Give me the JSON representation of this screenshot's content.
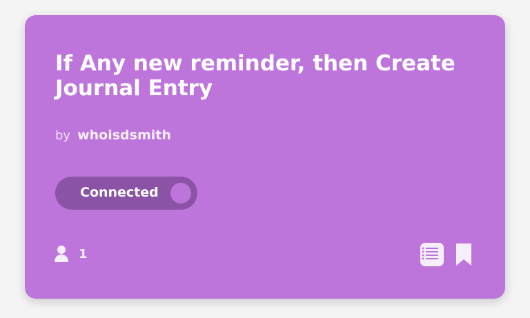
{
  "card": {
    "title": "If Any new reminder, then Create Journal Entry",
    "by_label": "by",
    "author": "whoisdsmith",
    "toggle": {
      "label": "Connected",
      "state": "on"
    },
    "users_count": "1",
    "icons": {
      "users": "person-icon",
      "service": "journal-icon",
      "save": "bookmark-icon"
    },
    "colors": {
      "card_background": "#bd75db",
      "toggle_background": "#8a53a6",
      "text": "#ffffff"
    }
  }
}
